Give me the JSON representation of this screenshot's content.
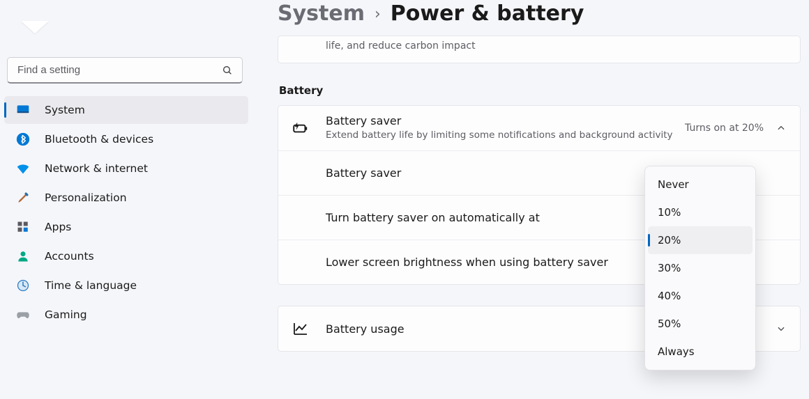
{
  "search": {
    "placeholder": "Find a setting"
  },
  "sidebar": {
    "items": [
      {
        "label": "System"
      },
      {
        "label": "Bluetooth & devices"
      },
      {
        "label": "Network & internet"
      },
      {
        "label": "Personalization"
      },
      {
        "label": "Apps"
      },
      {
        "label": "Accounts"
      },
      {
        "label": "Time & language"
      },
      {
        "label": "Gaming"
      }
    ]
  },
  "breadcrumb": {
    "parent": "System",
    "current": "Power & battery"
  },
  "tip_fragment": "life, and reduce carbon impact",
  "section": {
    "battery_label": "Battery"
  },
  "battery": {
    "saver": {
      "title": "Battery saver",
      "sub": "Extend battery life by limiting some notifications and background activity",
      "trail": "Turns on at 20%"
    },
    "rows": {
      "saver_toggle": "Battery saver",
      "auto_on": "Turn battery saver on automatically at",
      "brightness": "Lower screen brightness when using battery saver",
      "usage": "Battery usage"
    }
  },
  "dropdown": {
    "selected": "20%",
    "options": [
      "Never",
      "10%",
      "20%",
      "30%",
      "40%",
      "50%",
      "Always"
    ]
  }
}
